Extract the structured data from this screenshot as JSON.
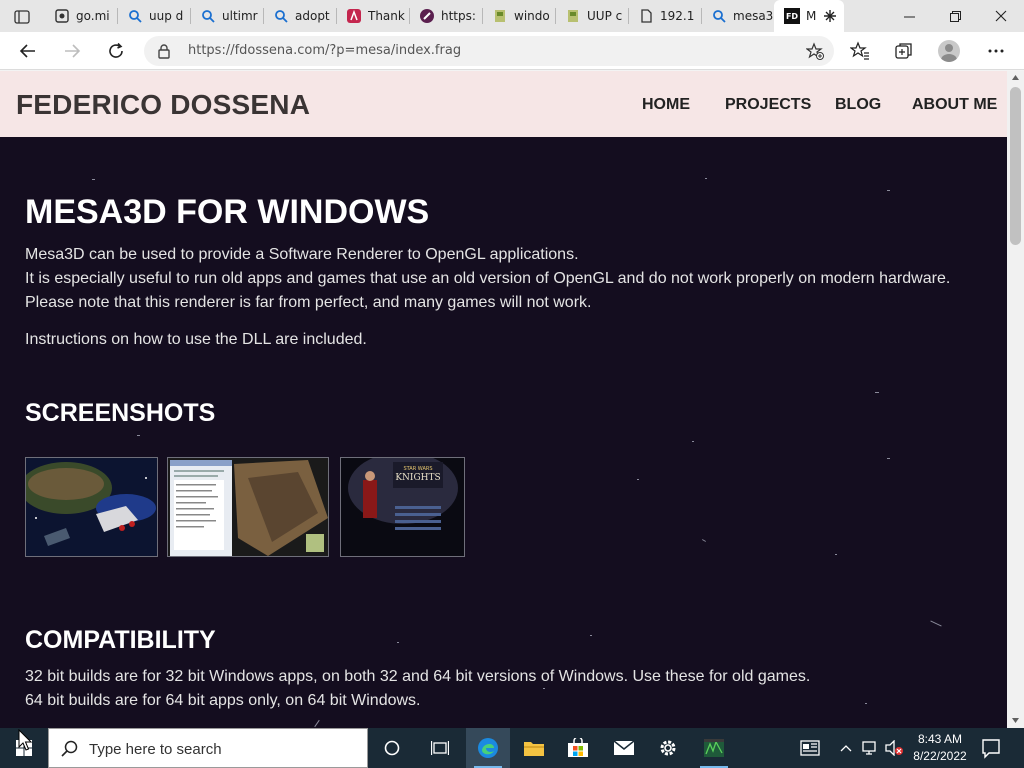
{
  "browser": {
    "tabs": [
      {
        "label": "go.mi",
        "icon": "page-icon"
      },
      {
        "label": "uup d",
        "icon": "search-icon"
      },
      {
        "label": "ultimr",
        "icon": "search-icon"
      },
      {
        "label": "adopt",
        "icon": "search-icon"
      },
      {
        "label": "Thank",
        "icon": "app-a-icon"
      },
      {
        "label": "https:",
        "icon": "app-circle-icon"
      },
      {
        "label": "windo",
        "icon": "installer-icon"
      },
      {
        "label": "UUP c",
        "icon": "installer-icon"
      },
      {
        "label": "192.1",
        "icon": "document-icon"
      },
      {
        "label": "mesa3",
        "icon": "search-icon"
      }
    ],
    "active_tab": {
      "label": "M",
      "favicon_text": "FD"
    },
    "url": "https://fdossena.com/?p=mesa/index.frag"
  },
  "site": {
    "title": "FEDERICO DOSSENA",
    "nav": [
      "HOME",
      "PROJECTS",
      "BLOG",
      "ABOUT ME"
    ]
  },
  "article": {
    "heading": "MESA3D FOR WINDOWS",
    "intro": [
      "Mesa3D can be used to provide a Software Renderer to OpenGL applications.",
      "It is especially useful to run old apps and games that use an old version of OpenGL and do not work properly on modern hardware.",
      "Please note that this renderer is far from perfect, and many games will not work."
    ],
    "instructions": "Instructions on how to use the DLL are included.",
    "screenshots_heading": "SCREENSHOTS",
    "screenshots_logo_text": "KNIGHTS",
    "compat_heading": "COMPATIBILITY",
    "compat": [
      "32 bit builds are for 32 bit Windows apps, on both 32 and 64 bit versions of Windows. Use these for old games.",
      "64 bit builds are for 64 bit apps only, on 64 bit Windows."
    ]
  },
  "taskbar": {
    "search_placeholder": "Type here to search",
    "time": "8:43 AM",
    "date": "8/22/2022"
  },
  "colors": {
    "header_bg": "#f6e6e6",
    "page_bg": "#140d1f",
    "taskbar_bg": "#1a2a36"
  }
}
